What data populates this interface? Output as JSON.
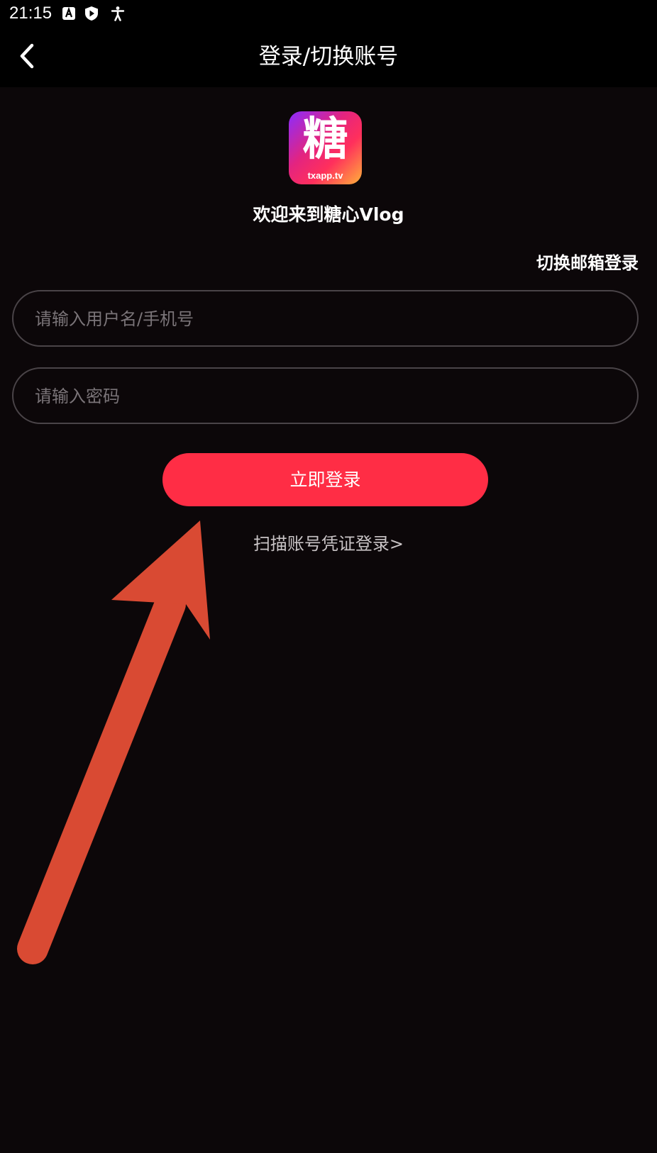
{
  "status_bar": {
    "time": "21:15",
    "icons": [
      "accessibility-a-icon",
      "play-shield-icon",
      "accessibility-person-icon"
    ]
  },
  "header": {
    "title": "登录/切换账号",
    "back_icon": "chevron-left-icon"
  },
  "logo": {
    "char": "糖",
    "domain": "txapp.tv"
  },
  "welcome": "欢迎来到糖心Vlog",
  "switch_email": "切换邮箱登录",
  "form": {
    "username_placeholder": "请输入用户名/手机号",
    "password_placeholder": "请输入密码",
    "login_label": "立即登录"
  },
  "scan_link": "扫描账号凭证登录>",
  "colors": {
    "background": "#0c0709",
    "accent": "#ff2d45",
    "annotation_arrow": "#d94a33"
  }
}
